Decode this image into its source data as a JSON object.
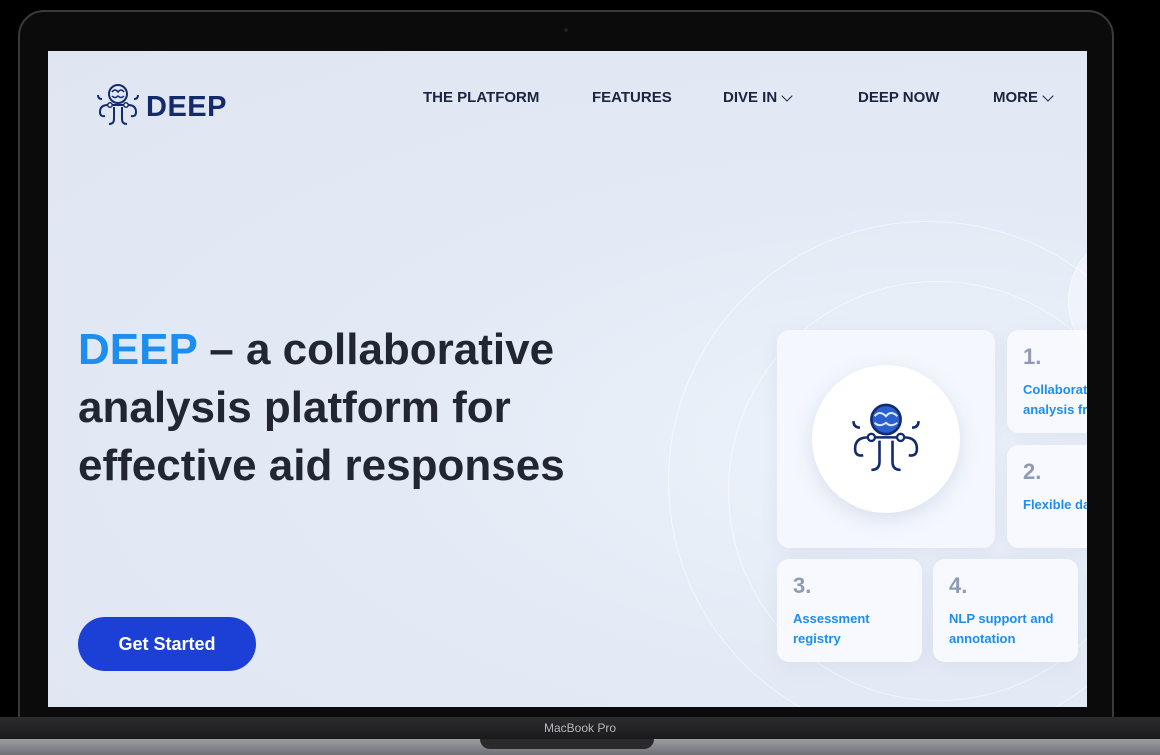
{
  "nav": {
    "brand": "DEEP",
    "items": [
      {
        "label": "THE PLATFORM",
        "dropdown": false
      },
      {
        "label": "FEATURES",
        "dropdown": false
      },
      {
        "label": "DIVE IN",
        "dropdown": true
      },
      {
        "label": "DEEP NOW",
        "dropdown": false
      },
      {
        "label": "MORE",
        "dropdown": true
      }
    ]
  },
  "hero": {
    "title_accent": "DEEP",
    "title_rest": "– a collaborative analysis platform for effective aid responses",
    "cta": "Get Started"
  },
  "features": [
    {
      "num": "1.",
      "label": "Collaborat analysis fr"
    },
    {
      "num": "2.",
      "label": "Flexible da"
    },
    {
      "num": "3.",
      "label": "Assessment registry"
    },
    {
      "num": "4.",
      "label": "NLP support and annotation"
    }
  ],
  "device": {
    "label": "MacBook Pro"
  },
  "colors": {
    "accent": "#1b8ef0",
    "cta": "#1c3fd6",
    "brand": "#132a6b",
    "background": "#e3eaf5"
  },
  "icons": {
    "logo": "octopus-brain-icon",
    "chevron": "chevron-down-icon"
  }
}
